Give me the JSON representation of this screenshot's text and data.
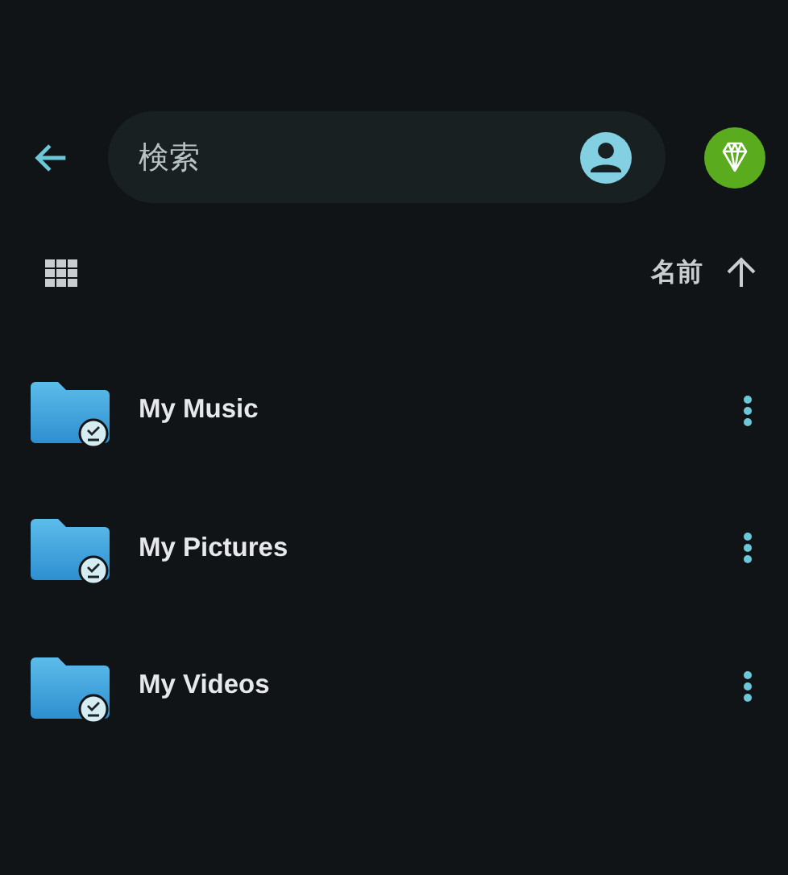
{
  "search": {
    "placeholder": "検索"
  },
  "sort": {
    "label": "名前",
    "ascending": true
  },
  "folders": [
    {
      "name": "My Music",
      "offline": true
    },
    {
      "name": "My Pictures",
      "offline": true
    },
    {
      "name": "My Videos",
      "offline": true
    }
  ]
}
